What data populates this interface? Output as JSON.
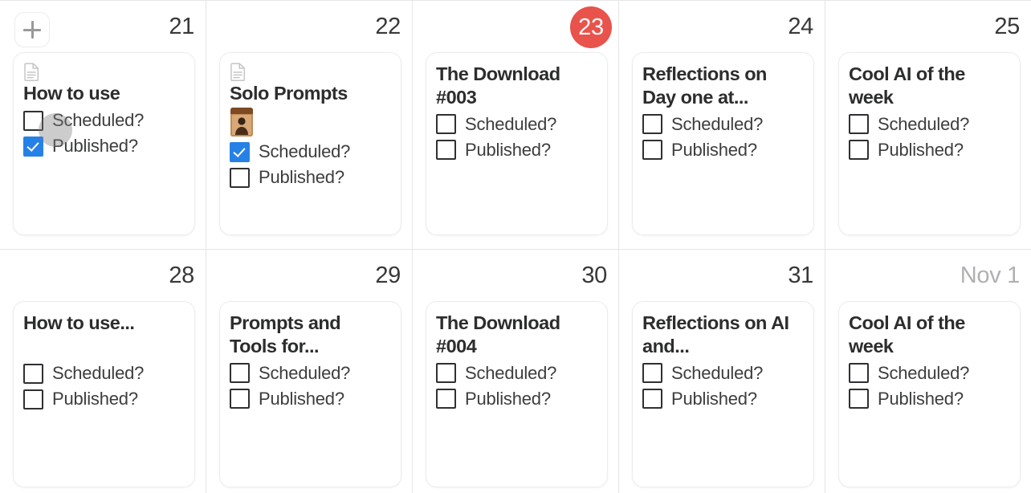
{
  "calendar": {
    "add_button_label": "+",
    "icons": {
      "add": "plus-icon",
      "document": "document-icon",
      "thumbnail": "image-thumbnail"
    },
    "colors": {
      "today_badge": "#e8534c",
      "today_badge_text": "#ffffff",
      "checkbox_checked": "#2581e6",
      "grid_line": "#e4e5e7",
      "card_border": "#ececec",
      "day_number": "#37383a",
      "day_number_muted": "#aeb0b3",
      "title_text": "#2c2d2e"
    },
    "checkbox_labels": {
      "scheduled": "Scheduled?",
      "published": "Published?"
    },
    "weeks": [
      {
        "days": [
          {
            "number": "21",
            "is_today": false,
            "is_other_month": false,
            "has_add_button": true,
            "has_cursor_overlay": true,
            "event": {
              "has_doc_icon": true,
              "has_thumbnail": false,
              "title": "How to use",
              "scheduled": false,
              "published": true
            }
          },
          {
            "number": "22",
            "is_today": false,
            "is_other_month": false,
            "has_add_button": false,
            "has_cursor_overlay": false,
            "event": {
              "has_doc_icon": true,
              "has_thumbnail": true,
              "title": "Solo Prompts",
              "scheduled": true,
              "published": false
            }
          },
          {
            "number": "23",
            "is_today": true,
            "is_other_month": false,
            "has_add_button": false,
            "has_cursor_overlay": false,
            "event": {
              "has_doc_icon": false,
              "has_thumbnail": false,
              "title": "The Download #003",
              "scheduled": false,
              "published": false
            }
          },
          {
            "number": "24",
            "is_today": false,
            "is_other_month": false,
            "has_add_button": false,
            "has_cursor_overlay": false,
            "event": {
              "has_doc_icon": false,
              "has_thumbnail": false,
              "title": "Reflections on Day one at...",
              "scheduled": false,
              "published": false
            }
          },
          {
            "number": "25",
            "is_today": false,
            "is_other_month": false,
            "has_add_button": false,
            "has_cursor_overlay": false,
            "event": {
              "has_doc_icon": false,
              "has_thumbnail": false,
              "title": "Cool AI of the week",
              "scheduled": false,
              "published": false
            }
          }
        ]
      },
      {
        "days": [
          {
            "number": "28",
            "is_today": false,
            "is_other_month": false,
            "has_add_button": false,
            "has_cursor_overlay": false,
            "event": {
              "has_doc_icon": false,
              "has_thumbnail": false,
              "title": "How to use...",
              "title_two_line_block": true,
              "scheduled": false,
              "published": false
            }
          },
          {
            "number": "29",
            "is_today": false,
            "is_other_month": false,
            "has_add_button": false,
            "has_cursor_overlay": false,
            "event": {
              "has_doc_icon": false,
              "has_thumbnail": false,
              "title": "Prompts and Tools for...",
              "scheduled": false,
              "published": false
            }
          },
          {
            "number": "30",
            "is_today": false,
            "is_other_month": false,
            "has_add_button": false,
            "has_cursor_overlay": false,
            "event": {
              "has_doc_icon": false,
              "has_thumbnail": false,
              "title": "The Download #004",
              "scheduled": false,
              "published": false
            }
          },
          {
            "number": "31",
            "is_today": false,
            "is_other_month": false,
            "has_add_button": false,
            "has_cursor_overlay": false,
            "event": {
              "has_doc_icon": false,
              "has_thumbnail": false,
              "title": "Reflections on AI and...",
              "scheduled": false,
              "published": false
            }
          },
          {
            "number": "Nov 1",
            "is_today": false,
            "is_other_month": true,
            "has_add_button": false,
            "has_cursor_overlay": false,
            "event": {
              "has_doc_icon": false,
              "has_thumbnail": false,
              "title": "Cool AI of the week",
              "scheduled": false,
              "published": false
            }
          }
        ]
      }
    ]
  }
}
